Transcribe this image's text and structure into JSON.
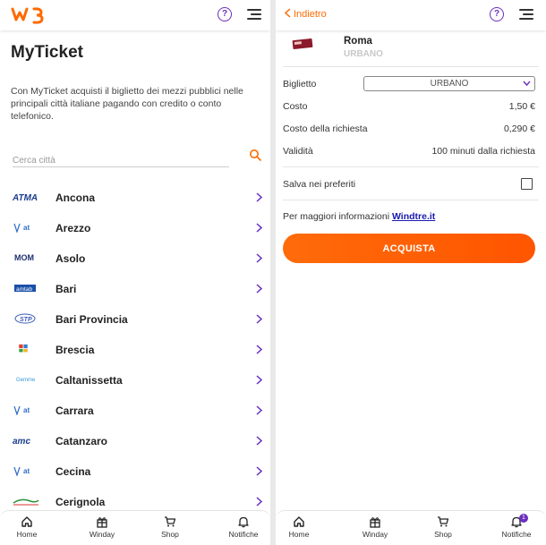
{
  "brand": {
    "logo_text": "W3",
    "accent": "#ff6b00",
    "purple": "#6b2fbf"
  },
  "left": {
    "title": "MyTicket",
    "description": "Con MyTicket acquisti il biglietto dei mezzi pubblici nelle principali città italiane pagando con credito o conto telefonico.",
    "search_placeholder": "Cerca città",
    "cities": [
      {
        "name": "Ancona",
        "logo": "ATMA"
      },
      {
        "name": "Arezzo",
        "logo": "at"
      },
      {
        "name": "Asolo",
        "logo": "MOM"
      },
      {
        "name": "Bari",
        "logo": "amtab"
      },
      {
        "name": "Bari Provincia",
        "logo": "STP"
      },
      {
        "name": "Brescia",
        "logo": "brescia mobilità"
      },
      {
        "name": "Caltanissetta",
        "logo": "Gemme"
      },
      {
        "name": "Carrara",
        "logo": "at"
      },
      {
        "name": "Catanzaro",
        "logo": "amc"
      },
      {
        "name": "Cecina",
        "logo": "at"
      },
      {
        "name": "Cerignola",
        "logo": "cerignola"
      }
    ]
  },
  "nav": {
    "items": [
      {
        "label": "Home",
        "icon": "home-icon"
      },
      {
        "label": "Winday",
        "icon": "gift-icon"
      },
      {
        "label": "Shop",
        "icon": "cart-icon"
      },
      {
        "label": "Notifiche",
        "icon": "bell-icon"
      }
    ],
    "badge_count": "1"
  },
  "right": {
    "back_label": "Indietro",
    "ticket_city": "Roma",
    "ticket_type": "URBANO",
    "biglietto_label": "Biglietto",
    "biglietto_selected": "URBANO",
    "costo_label": "Costo",
    "costo_value": "1,50 €",
    "costo_richiesta_label": "Costo della richiesta",
    "costo_richiesta_value": "0,290 €",
    "validita_label": "Validità",
    "validita_value": "100 minuti dalla richiesta",
    "preferiti_label": "Salva nei preferiti",
    "info_text": "Per maggiori informazioni ",
    "info_link": "Windtre.it",
    "buy_label": "ACQUISTA"
  }
}
